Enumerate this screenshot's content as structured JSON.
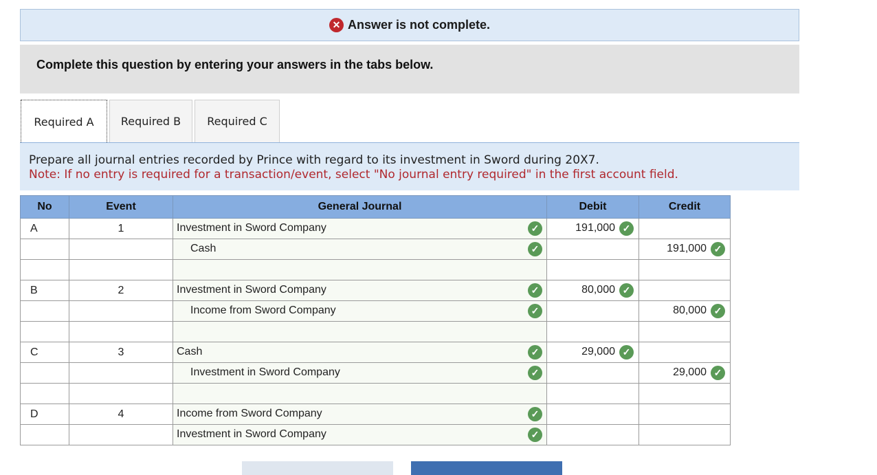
{
  "banner": {
    "icon": "x-circle-icon",
    "icon_glyph": "✕",
    "text": "Answer is not complete."
  },
  "instructions": {
    "text": "Complete this question by entering your answers in the tabs below."
  },
  "tabs": [
    {
      "label": "Required A",
      "active": true
    },
    {
      "label": "Required B",
      "active": false
    },
    {
      "label": "Required C",
      "active": false
    }
  ],
  "prompt": {
    "line1": "Prepare all journal entries recorded by Prince with regard to its investment in Sword during 20X7.",
    "note": "Note: If no entry is required for a transaction/event, select \"No journal entry required\" in the first account field."
  },
  "table": {
    "headers": {
      "no": "No",
      "event": "Event",
      "journal": "General Journal",
      "debit": "Debit",
      "credit": "Credit"
    },
    "check_glyph": "✓",
    "rows": [
      {
        "no": "A",
        "event": "1",
        "account": "Investment in Sword Company",
        "indent": false,
        "acct_check": true,
        "debit": "191,000",
        "debit_check": true,
        "credit": "",
        "credit_check": false
      },
      {
        "no": "",
        "event": "",
        "account": "Cash",
        "indent": true,
        "acct_check": true,
        "debit": "",
        "debit_check": false,
        "credit": "191,000",
        "credit_check": true
      },
      {
        "no": "",
        "event": "",
        "account": "",
        "indent": false,
        "acct_check": false,
        "debit": "",
        "debit_check": false,
        "credit": "",
        "credit_check": false
      },
      {
        "no": "B",
        "event": "2",
        "account": "Investment in Sword Company",
        "indent": false,
        "acct_check": true,
        "debit": "80,000",
        "debit_check": true,
        "credit": "",
        "credit_check": false
      },
      {
        "no": "",
        "event": "",
        "account": "Income from Sword Company",
        "indent": true,
        "acct_check": true,
        "debit": "",
        "debit_check": false,
        "credit": "80,000",
        "credit_check": true
      },
      {
        "no": "",
        "event": "",
        "account": "",
        "indent": false,
        "acct_check": false,
        "debit": "",
        "debit_check": false,
        "credit": "",
        "credit_check": false
      },
      {
        "no": "C",
        "event": "3",
        "account": "Cash",
        "indent": false,
        "acct_check": true,
        "debit": "29,000",
        "debit_check": true,
        "credit": "",
        "credit_check": false
      },
      {
        "no": "",
        "event": "",
        "account": "Investment in Sword Company",
        "indent": true,
        "acct_check": true,
        "debit": "",
        "debit_check": false,
        "credit": "29,000",
        "credit_check": true
      },
      {
        "no": "",
        "event": "",
        "account": "",
        "indent": false,
        "acct_check": false,
        "debit": "",
        "debit_check": false,
        "credit": "",
        "credit_check": false
      },
      {
        "no": "D",
        "event": "4",
        "account": "Income from Sword Company",
        "indent": false,
        "acct_check": true,
        "debit": "",
        "debit_check": false,
        "credit": "",
        "credit_check": false
      },
      {
        "no": "",
        "event": "",
        "account": "Investment in Sword Company",
        "indent": false,
        "acct_check": true,
        "debit": "",
        "debit_check": false,
        "credit": "",
        "credit_check": false
      }
    ]
  },
  "buttons": {
    "prev_color": "#dfe6ef",
    "next_color": "#3f6fb1"
  },
  "colors": {
    "error_red": "#c0282d",
    "check_green": "#5a9a57",
    "header_blue": "#86ade0",
    "note_red": "#b0282e"
  }
}
